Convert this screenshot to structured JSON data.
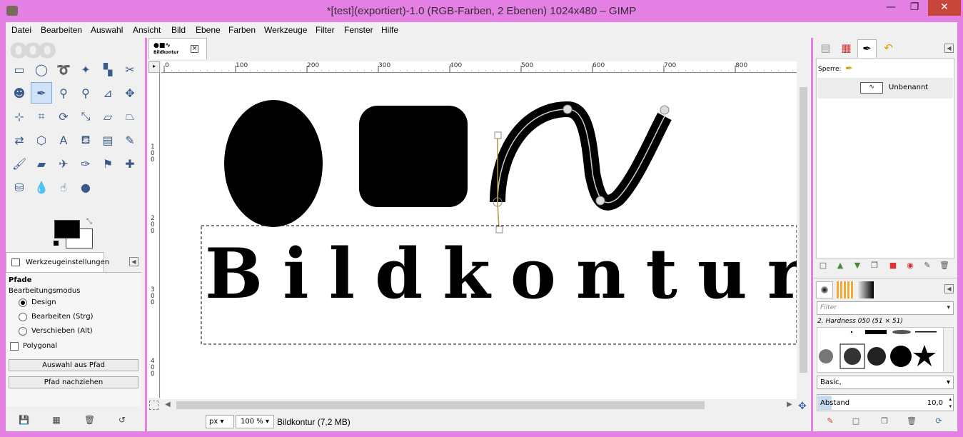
{
  "window": {
    "title": "*[test](exportiert)-1.0 (RGB-Farben, 2 Ebenen) 1024x480 – GIMP",
    "min_glyph": "—",
    "max_glyph": "❐",
    "close_glyph": "✕"
  },
  "menu": [
    "Datei",
    "Bearbeiten",
    "Auswahl",
    "Ansicht",
    "Bild",
    "Ebene",
    "Farben",
    "Werkzeuge",
    "Filter",
    "Fenster",
    "Hilfe"
  ],
  "toolbox": {
    "tools": [
      {
        "name": "rect-select-icon",
        "glyph": "▭"
      },
      {
        "name": "ellipse-select-icon",
        "glyph": "◯"
      },
      {
        "name": "free-select-icon",
        "glyph": "➰"
      },
      {
        "name": "fuzzy-select-icon",
        "glyph": "✦"
      },
      {
        "name": "color-select-icon",
        "glyph": "▚"
      },
      {
        "name": "scissors-icon",
        "glyph": "✂"
      },
      {
        "name": "foreground-select-icon",
        "glyph": "☻"
      },
      {
        "name": "paths-tool-icon",
        "glyph": "✒"
      },
      {
        "name": "color-picker-icon",
        "glyph": "⚲"
      },
      {
        "name": "zoom-icon",
        "glyph": "⚲"
      },
      {
        "name": "measure-icon",
        "glyph": "⊿"
      },
      {
        "name": "move-icon",
        "glyph": "✥"
      },
      {
        "name": "align-icon",
        "glyph": "⊹"
      },
      {
        "name": "crop-icon",
        "glyph": "⌗"
      },
      {
        "name": "rotate-icon",
        "glyph": "⟳"
      },
      {
        "name": "scale-icon",
        "glyph": "⤡"
      },
      {
        "name": "shear-icon",
        "glyph": "▱"
      },
      {
        "name": "perspective-icon",
        "glyph": "⏢"
      },
      {
        "name": "flip-icon",
        "glyph": "⇄"
      },
      {
        "name": "cage-icon",
        "glyph": "⬡"
      },
      {
        "name": "text-icon",
        "glyph": "A"
      },
      {
        "name": "bucket-fill-icon",
        "glyph": "⛾"
      },
      {
        "name": "gradient-icon",
        "glyph": "▤"
      },
      {
        "name": "pencil-icon",
        "glyph": "✎"
      },
      {
        "name": "paintbrush-icon",
        "glyph": "🖌"
      },
      {
        "name": "eraser-icon",
        "glyph": "▰"
      },
      {
        "name": "airbrush-icon",
        "glyph": "✈"
      },
      {
        "name": "ink-icon",
        "glyph": "✑"
      },
      {
        "name": "clone-icon",
        "glyph": "⚑"
      },
      {
        "name": "heal-icon",
        "glyph": "✚"
      },
      {
        "name": "perspective-clone-icon",
        "glyph": "⛁"
      },
      {
        "name": "blur-icon",
        "glyph": "💧"
      },
      {
        "name": "smudge-icon",
        "glyph": "☝"
      },
      {
        "name": "dodge-burn-icon",
        "glyph": "●"
      }
    ],
    "options_tab_label": "Werkzeugeinstellungen",
    "tool_title": "Pfade",
    "edit_mode_label": "Bearbeitungsmodus",
    "modes": [
      "Design",
      "Bearbeiten (Strg)",
      "Verschieben (Alt)"
    ],
    "selected_mode": "Design",
    "polygonal_label": "Polygonal",
    "polygonal_checked": false,
    "btn_selection_from_path": "Auswahl aus Pfad",
    "btn_stroke_path": "Pfad nachziehen"
  },
  "image": {
    "tab_thumb_label": "Bildkontur",
    "canvas_text": "Bildkontur",
    "ruler_h_ticks": [
      "0",
      "100",
      "200",
      "300",
      "400",
      "500",
      "600",
      "700",
      "800"
    ],
    "ruler_v_ticks": [
      "100",
      "200",
      "300",
      "400"
    ],
    "unit": "px",
    "zoom": "100 %",
    "status": "Bildkontur (7,2 MB)"
  },
  "paths_dock": {
    "lock_label": "Sperre:",
    "path_name": "Unbenannt"
  },
  "brushes_dock": {
    "filter_placeholder": "Filter",
    "brush_label": "2. Hardness 050 (51 × 51)",
    "preset": "Basic,",
    "spacing_label": "Abstand",
    "spacing_value": "10,0"
  },
  "colors": {
    "window_frame": "#e47fe4",
    "close_button": "#c7453a",
    "panel_bg": "#f0f0f0"
  }
}
